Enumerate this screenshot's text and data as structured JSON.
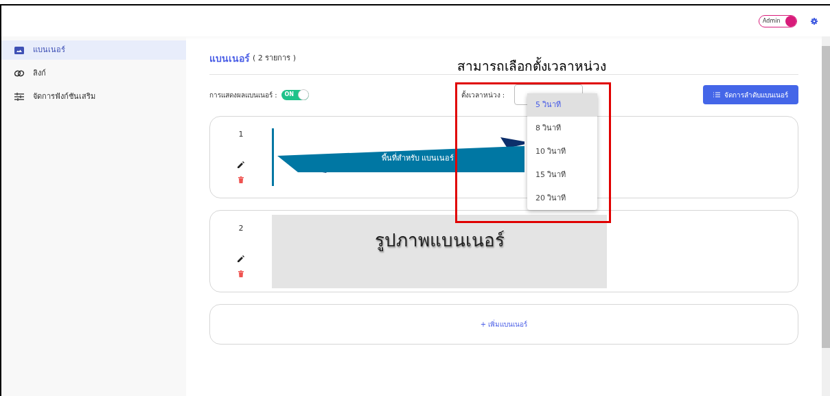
{
  "header": {
    "role_switch": {
      "label": "Admin",
      "on": true
    }
  },
  "sidebar": {
    "items": [
      {
        "label": "แบนเนอร์",
        "kind": "image",
        "selected": true
      },
      {
        "label": "ลิงก์",
        "kind": "link",
        "selected": false
      },
      {
        "label": "จัดการฟังก์ชันเสริม",
        "kind": "sliders",
        "selected": false
      }
    ]
  },
  "page": {
    "title": "แบนเนอร์",
    "count": "( 2 รายการ )",
    "display_toggle": {
      "label": "การแสดงผลแบนเนอร์ :",
      "on": true,
      "text": "ON"
    },
    "interval": {
      "label": "ตั้งเวลาหน่วง :",
      "expanded": true,
      "options": [
        {
          "label": "5 วินาที",
          "selected": true
        },
        {
          "label": "8 วินาที",
          "selected": false
        },
        {
          "label": "10 วินาที",
          "selected": false
        },
        {
          "label": "15 วินาที",
          "selected": false
        },
        {
          "label": "20 วินาที",
          "selected": false
        }
      ]
    },
    "sort_button": "จัดการลำดับแบนเนอร์",
    "banners": [
      {
        "index": "1",
        "kind": "ribbon",
        "caption": "พื้นที่สำหรับ แบนเนอร์"
      },
      {
        "index": "2",
        "kind": "placeholder",
        "caption": "รูปภาพแบนเนอร์"
      }
    ],
    "add_button": "+ เพิ่มแบนเนอร์"
  },
  "annotation": {
    "text": "สามารถเลือกตั้งเวลาหน่วง"
  }
}
